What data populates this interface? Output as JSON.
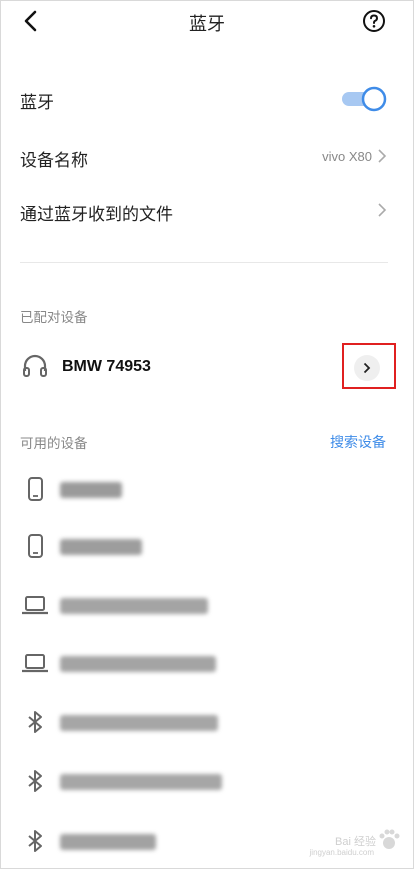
{
  "header": {
    "title": "蓝牙",
    "back_icon": "back-icon",
    "help_icon": "help-icon"
  },
  "settings": {
    "bluetooth_label": "蓝牙",
    "bluetooth_on": true,
    "device_name_label": "设备名称",
    "device_name_value": "vivo X80",
    "received_files_label": "通过蓝牙收到的文件"
  },
  "paired": {
    "section_label": "已配对设备",
    "device_name": "BMW 74953",
    "device_icon": "headphones-icon"
  },
  "available": {
    "section_label": "可用的设备",
    "search_label": "搜索设备",
    "devices": [
      {
        "icon": "phone-icon"
      },
      {
        "icon": "phone-icon"
      },
      {
        "icon": "laptop-icon"
      },
      {
        "icon": "laptop-icon"
      },
      {
        "icon": "bluetooth-icon"
      },
      {
        "icon": "bluetooth-icon"
      },
      {
        "icon": "bluetooth-icon"
      }
    ]
  },
  "colors": {
    "accent": "#3f8ce8",
    "highlight": "#e02020"
  },
  "watermark": {
    "text": "Bai 经验",
    "url": "jingyan.baidu.com"
  }
}
